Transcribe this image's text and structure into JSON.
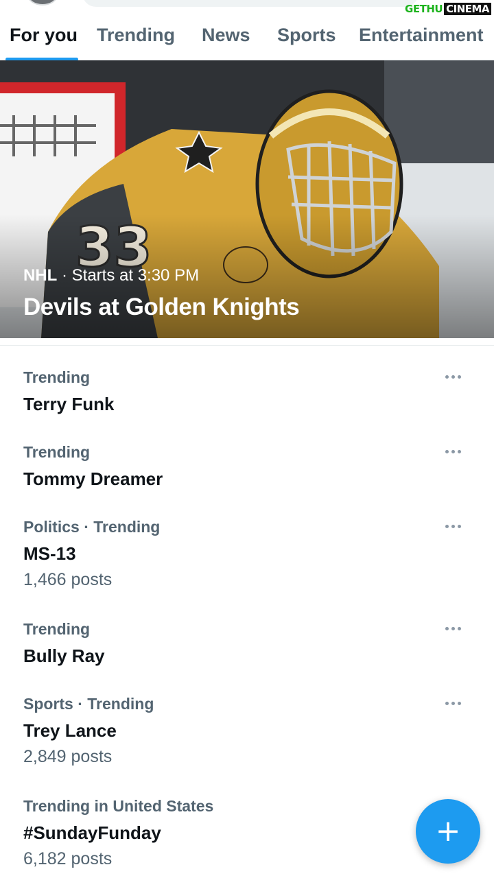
{
  "watermark": {
    "part_a": "GETHU",
    "part_b": "CINEMA"
  },
  "tabs": [
    {
      "label": "For you",
      "active": true
    },
    {
      "label": "Trending",
      "active": false
    },
    {
      "label": "News",
      "active": false
    },
    {
      "label": "Sports",
      "active": false
    },
    {
      "label": "Entertainment",
      "active": false
    }
  ],
  "hero": {
    "league": "NHL",
    "separator": " · ",
    "time": "Starts at 3:30 PM",
    "title": "Devils at Golden Knights"
  },
  "trends": [
    {
      "context": "Trending",
      "name": "Terry Funk",
      "count": ""
    },
    {
      "context": "Trending",
      "name": "Tommy Dreamer",
      "count": ""
    },
    {
      "context": "Politics · Trending",
      "name": "MS-13",
      "count": "1,466 posts"
    },
    {
      "context": "Trending",
      "name": "Bully Ray",
      "count": ""
    },
    {
      "context": "Sports · Trending",
      "name": "Trey Lance",
      "count": "2,849 posts"
    },
    {
      "context": "Trending in United States",
      "name": "#SundayFunday",
      "count": "6,182 posts"
    }
  ],
  "fab": {
    "icon": "plus-icon",
    "glyph": "+"
  },
  "colors": {
    "accent": "#1d9bf0",
    "secondary_text": "#536471",
    "primary_text": "#0f1419"
  }
}
